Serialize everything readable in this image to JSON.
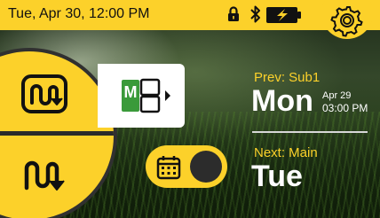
{
  "status_bar": {
    "datetime": "Tue, Apr 30, 12:00 PM",
    "icons": [
      "lock-icon",
      "bluetooth-icon",
      "battery-charging-icon"
    ]
  },
  "settings": {
    "icon": "gear-icon"
  },
  "modes": [
    {
      "name": "manual-mode",
      "icon": "boxed-wave-arrow-icon"
    },
    {
      "name": "auto-mode",
      "icon": "wave-arrow-icon"
    }
  ],
  "schedule_card": {
    "badge": "M",
    "icon": "schedule-blocks-icon"
  },
  "calendar_toggle": {
    "icon": "calendar-icon"
  },
  "prev": {
    "label": "Prev: Sub1",
    "day": "Mon",
    "date": "Apr 29",
    "time": "03:00 PM"
  },
  "next": {
    "label": "Next: Main",
    "day": "Tue"
  },
  "colors": {
    "accent": "#fcd12a",
    "dark": "#2c2c2c",
    "green": "#3a9a3a"
  }
}
